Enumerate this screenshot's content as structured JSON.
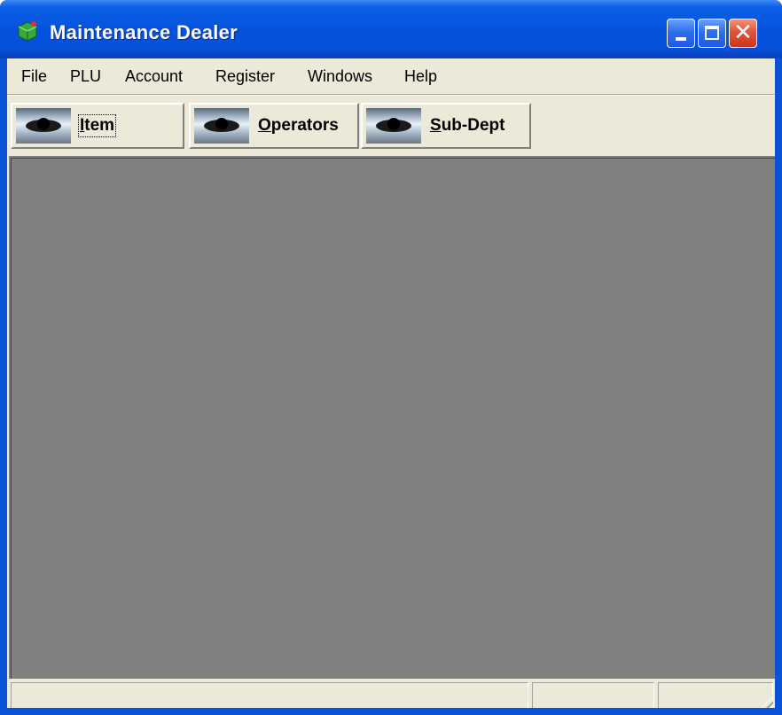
{
  "window": {
    "title": "Maintenance Dealer",
    "controls": [
      "minimize",
      "maximize",
      "close"
    ],
    "colors": {
      "titlebar": "#0553dd",
      "client": "#ece9d8",
      "mdi_background": "#808080",
      "close_button": "#e0553a"
    }
  },
  "menu": {
    "items": [
      "File",
      "PLU",
      "Account",
      "Register",
      "Windows",
      "Help"
    ]
  },
  "toolbar": {
    "buttons": [
      {
        "label": "Item",
        "accel": "I",
        "rest": "tem",
        "icon": "eye-icon"
      },
      {
        "label": "Operators",
        "accel": "O",
        "rest": "perators",
        "icon": "eye-icon"
      },
      {
        "label": "Sub-Dept",
        "accel": "S",
        "rest": "ub-Dept",
        "icon": "eye-icon"
      }
    ]
  },
  "statusbar": {
    "panes": [
      "",
      "",
      ""
    ]
  }
}
